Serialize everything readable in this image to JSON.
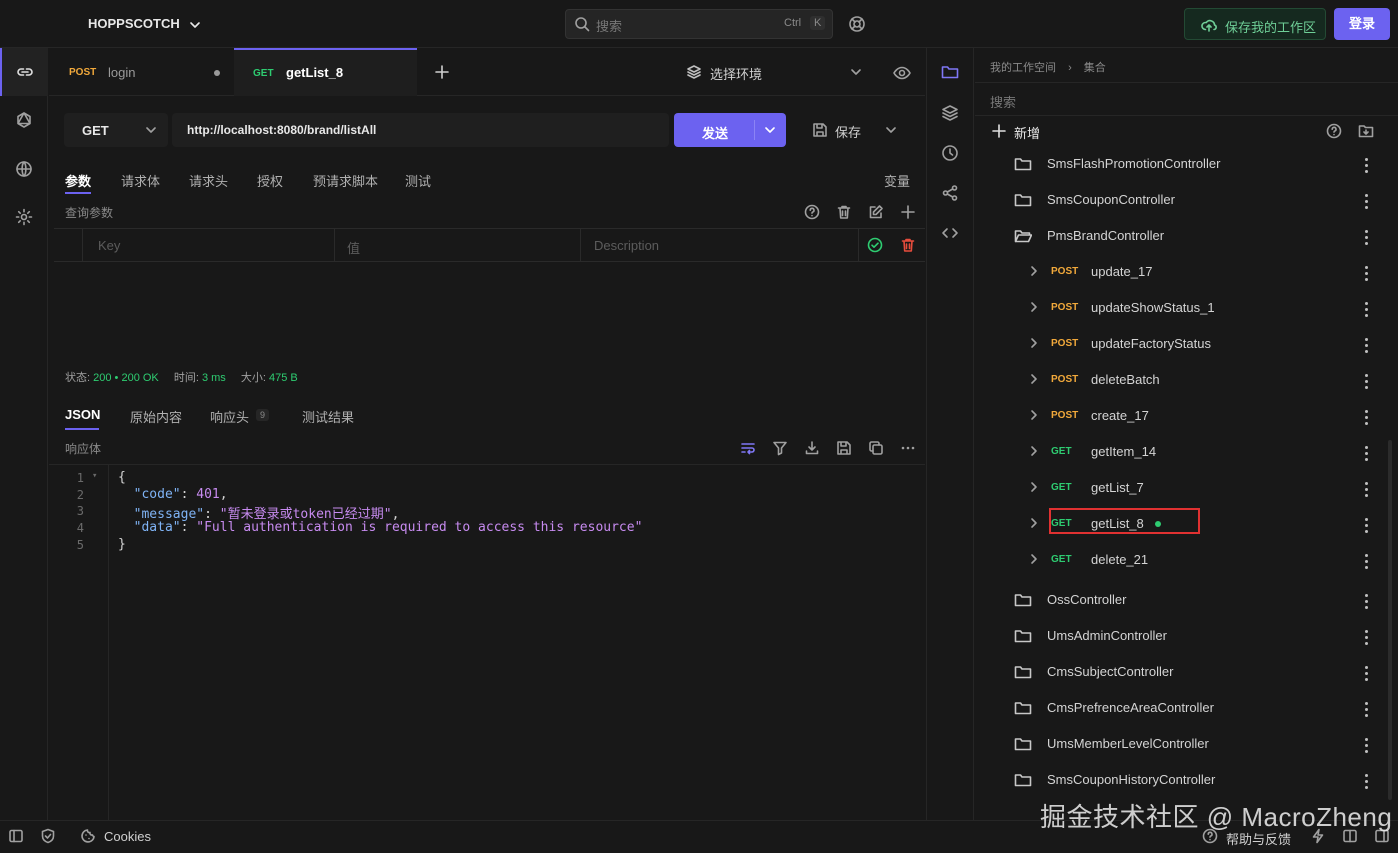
{
  "app": {
    "brand": "HOPPSCOTCH"
  },
  "header": {
    "search_placeholder": "搜索",
    "shortcut_mod": "Ctrl",
    "shortcut_key": "K",
    "save_workspace_label": "保存我的工作区",
    "login_label": "登录"
  },
  "tabs": [
    {
      "method": "POST",
      "name": "login"
    },
    {
      "method": "GET",
      "name": "getList_8"
    }
  ],
  "environment": {
    "label": "选择环境"
  },
  "request": {
    "method": "GET",
    "url": "http://localhost:8080/brand/listAll",
    "send_label": "发送",
    "save_label": "保存"
  },
  "request_tabs": [
    "参数",
    "请求体",
    "请求头",
    "授权",
    "预请求脚本",
    "测试"
  ],
  "variables_label": "变量",
  "params": {
    "title": "查询参数",
    "columns": [
      "Key",
      "值",
      "Description"
    ]
  },
  "response": {
    "status_label": "状态:",
    "status_code": "200",
    "status_text": "200 OK",
    "time_label": "时间:",
    "time_value": "3 ms",
    "size_label": "大小:",
    "size_value": "475 B",
    "tabs": [
      "JSON",
      "原始内容",
      "响应头",
      "测试结果"
    ],
    "headers_count": "9",
    "body_label": "响应体",
    "code_lines": [
      {
        "num": "1",
        "text": "{"
      },
      {
        "num": "2",
        "key": "\"code\"",
        "value": "401"
      },
      {
        "num": "3",
        "key": "\"message\"",
        "value": "\"暂未登录或token已经过期\""
      },
      {
        "num": "4",
        "key": "\"data\"",
        "value": "\"Full authentication is required to access this resource\""
      },
      {
        "num": "5",
        "text": "}"
      }
    ]
  },
  "collections": {
    "breadcrumb_root": "我的工作空间",
    "breadcrumb_current": "集合",
    "search_placeholder": "搜索",
    "new_label": "新增",
    "items": [
      {
        "type": "folder",
        "label": "SmsFlashPromotionController"
      },
      {
        "type": "folder",
        "label": "SmsCouponController"
      },
      {
        "type": "folder-open",
        "label": "PmsBrandController"
      },
      {
        "type": "request",
        "method": "POST",
        "label": "update_17"
      },
      {
        "type": "request",
        "method": "POST",
        "label": "updateShowStatus_1"
      },
      {
        "type": "request",
        "method": "POST",
        "label": "updateFactoryStatus"
      },
      {
        "type": "request",
        "method": "POST",
        "label": "deleteBatch"
      },
      {
        "type": "request",
        "method": "POST",
        "label": "create_17"
      },
      {
        "type": "request",
        "method": "GET",
        "label": "getItem_14"
      },
      {
        "type": "request",
        "method": "GET",
        "label": "getList_7"
      },
      {
        "type": "request",
        "method": "GET",
        "label": "getList_8",
        "highlighted": true
      },
      {
        "type": "request",
        "method": "GET",
        "label": "delete_21"
      },
      {
        "type": "folder",
        "label": "OssController"
      },
      {
        "type": "folder",
        "label": "UmsAdminController"
      },
      {
        "type": "folder",
        "label": "CmsSubjectController"
      },
      {
        "type": "folder",
        "label": "CmsPrefrenceAreaController"
      },
      {
        "type": "folder",
        "label": "UmsMemberLevelController"
      },
      {
        "type": "folder",
        "label": "SmsCouponHistoryController"
      }
    ]
  },
  "statusbar": {
    "cookies_label": "Cookies",
    "help_label": "帮助与反馈"
  },
  "watermark": "掘金技术社区 @ MacroZheng",
  "colors": {
    "accent": "#6c62f0",
    "post": "#f2a93b",
    "get": "#2ecc71",
    "highlight_box": "#e03131"
  }
}
